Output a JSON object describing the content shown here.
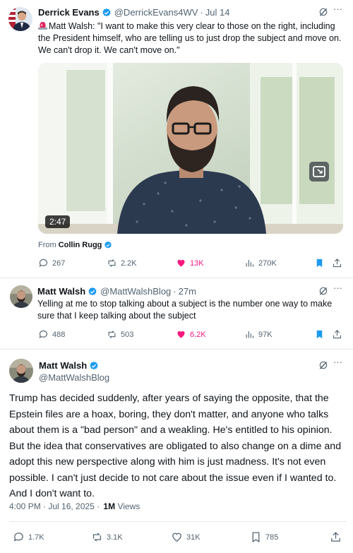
{
  "tweet1": {
    "display_name": "Derrick Evans",
    "handle": "@DerrickEvans4WV",
    "separator": "·",
    "time": "Jul 14",
    "alert_icon": "rotating-light-emoji",
    "text": "Matt Walsh: \"I want to make this very clear to those on the right, including the President himself, who are telling us to just drop the subject and move on. We can't drop it. We can't move on.\"",
    "video": {
      "duration": "2:47"
    },
    "from_label": "From",
    "from_name": "Collin Rugg",
    "actions": {
      "replies": "267",
      "reposts": "2.2K",
      "likes": "13K",
      "views": "270K"
    }
  },
  "tweet2": {
    "display_name": "Matt Walsh",
    "handle": "@MattWalshBlog",
    "separator": "·",
    "time": "27m",
    "text": "Yelling at me to stop talking about a subject is the number one way to make sure that I keep talking about the subject",
    "actions": {
      "replies": "488",
      "reposts": "503",
      "likes": "6.2K",
      "views": "97K"
    }
  },
  "tweet3": {
    "display_name": "Matt Walsh",
    "handle": "@MattWalshBlog",
    "text": "Trump has decided suddenly, after years of saying the opposite, that the Epstein files are a hoax, boring, they don't matter, and anyone who talks about them is a \"bad person\" and a weakling. He's entitled to his opinion. But the idea that conservatives are obligated to also change on a dime and adopt this new perspective along with him is just madness. It's not even possible. I can't just decide to not care about the issue even if I wanted to. And I don't want to.",
    "meta_time": "4:00 PM · Jul 16, 2025 ·",
    "meta_views_count": "1M",
    "meta_views_label": "Views",
    "actions": {
      "replies": "1.7K",
      "reposts": "3.1K",
      "likes": "31K",
      "bookmarks": "785"
    }
  },
  "colors": {
    "text": "#0f1419",
    "secondary": "#536471",
    "like_pink": "#f91880",
    "verified_blue": "#1d9bf0",
    "bookmark_blue": "#1d9bf0",
    "divider": "#e1e8ed"
  }
}
